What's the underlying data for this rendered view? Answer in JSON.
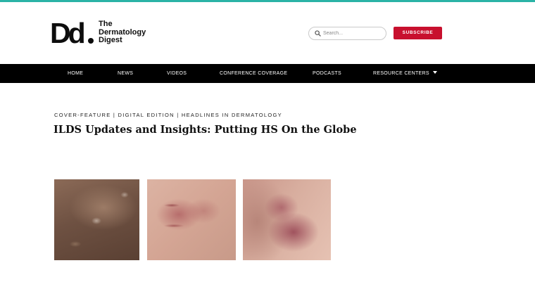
{
  "logo": {
    "mark": "Dd",
    "lines": [
      "The",
      "Dermatology",
      "Digest"
    ]
  },
  "search": {
    "placeholder": "Search..."
  },
  "header": {
    "subscribe_label": "SUBSCRIBE"
  },
  "nav": {
    "items": [
      {
        "label": "HOME"
      },
      {
        "label": "NEWS"
      },
      {
        "label": "VIDEOS"
      },
      {
        "label": "CONFERENCE COVERAGE"
      },
      {
        "label": "PODCASTS"
      },
      {
        "label": "RESOURCE CENTERS"
      }
    ]
  },
  "article": {
    "categories": "COVER-FEATURE | DIGITAL EDITION | HEADLINES IN DERMATOLOGY",
    "title": "ILDS Updates and Insights: Putting HS On the Globe"
  },
  "colors": {
    "accent_bar": "#2ab3a6",
    "subscribe": "#c8102e",
    "nav_bg": "#000000"
  },
  "icons": {
    "search": "search-icon",
    "dropdown": "caret-down-icon"
  }
}
